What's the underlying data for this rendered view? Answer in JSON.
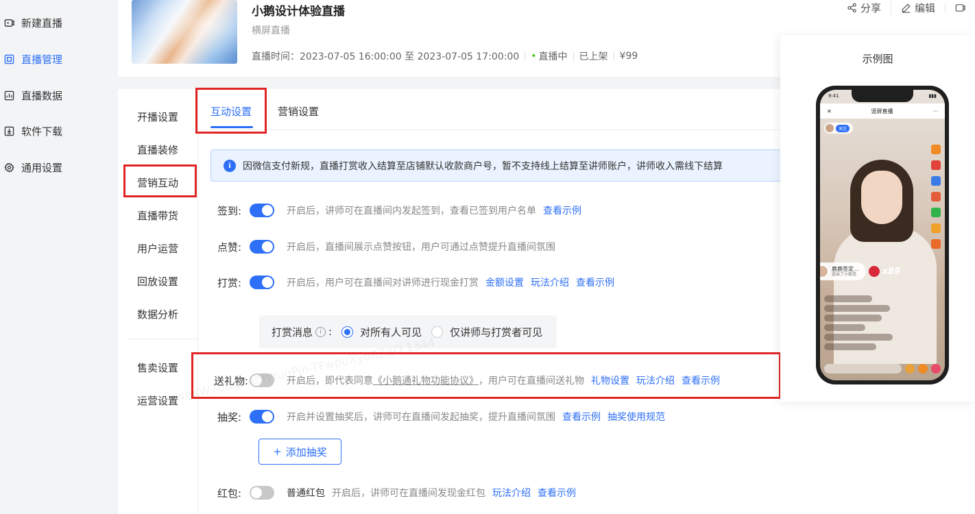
{
  "sidebar": {
    "items": [
      {
        "label": "新建直播",
        "icon": "video-plus-icon"
      },
      {
        "label": "直播管理",
        "icon": "live-manage-icon",
        "active": true
      },
      {
        "label": "直播数据",
        "icon": "data-chart-icon"
      },
      {
        "label": "软件下载",
        "icon": "download-icon"
      },
      {
        "label": "通用设置",
        "icon": "gear-icon"
      }
    ]
  },
  "live": {
    "title": "小鹅设计体验直播",
    "type": "横屏直播",
    "time_label": "直播时间：",
    "time_range": "2023-07-05 16:00:00 至 2023-07-05 17:00:00",
    "status": "直播中",
    "shelf": "已上架",
    "price": "¥99"
  },
  "top_actions": {
    "share": "分享",
    "edit": "编辑"
  },
  "subnav": {
    "items": [
      "开播设置",
      "直播装修",
      "营销互动",
      "直播带货",
      "用户运营",
      "回放设置",
      "数据分析"
    ],
    "items2": [
      "售卖设置",
      "运营设置"
    ],
    "active": "营销互动"
  },
  "tabs": {
    "interactive": "互动设置",
    "marketing": "营销设置"
  },
  "notice": {
    "text": "因微信支付新规，直播打赏收入结算至店铺默认收款商户号，暂不支持线上结算至讲师账户，讲师收入需线下结算"
  },
  "settings": {
    "checkin": {
      "label": "签到:",
      "enabled": true,
      "desc": "开启后，讲师可在直播间内发起签到，查看已签到用户名单",
      "link1": "查看示例"
    },
    "like": {
      "label": "点赞:",
      "enabled": true,
      "desc": "开启后，直播间展示点赞按钮，用户可通过点赞提升直播间氛围"
    },
    "reward": {
      "label": "打赏:",
      "enabled": true,
      "desc": "开启后，用户可在直播间对讲师进行现金打赏",
      "link1": "金额设置",
      "link2": "玩法介绍",
      "link3": "查看示例"
    },
    "reward_msg": {
      "label": "打赏消息",
      "colon": ":",
      "option1": "对所有人可见",
      "option2": "仅讲师与打赏者可见",
      "selected": 1
    },
    "gift": {
      "label": "送礼物:",
      "enabled": false,
      "desc_prefix": "开启后，即代表同意",
      "agreement": "《小鹅通礼物功能协议》",
      "desc_suffix": "，用户可在直播间送礼物",
      "link1": "礼物设置",
      "link2": "玩法介绍",
      "link3": "查看示例"
    },
    "lottery": {
      "label": "抽奖:",
      "enabled": true,
      "desc": "开启并设置抽奖后，讲师可在直播间发起抽奖，提升直播间氛围",
      "link1": "查看示例",
      "link2": "抽奖使用规范",
      "add_button": "添加抽奖"
    },
    "redpacket": {
      "label": "红包:",
      "enabled": false,
      "type": "普通红包",
      "desc": "开启后，讲师可在直播间发现金红包",
      "link1": "玩法介绍",
      "link2": "查看示例"
    }
  },
  "example": {
    "title": "示例图",
    "phone": {
      "time": "9:41",
      "header": "竖屏直播",
      "follow": "关注",
      "gift_user": "鹿鹿签定...",
      "gift_text": "送出了小玫花",
      "gift_count": "x89"
    }
  },
  "watermark": "woKW7bBg4AbfWugPin-TFwpuXyoRZgQ 1344",
  "colors": {
    "accent": "#2d6ff6",
    "highlight": "#e02424",
    "success": "#52c41a"
  }
}
